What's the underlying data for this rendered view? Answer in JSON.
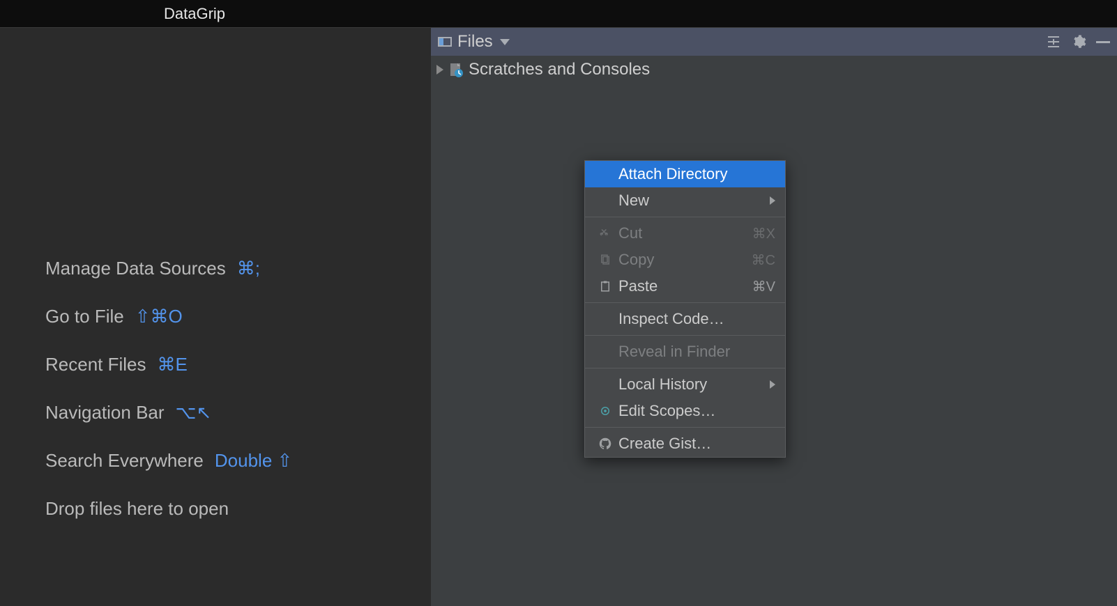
{
  "title": "DataGrip",
  "left": {
    "tips": [
      {
        "label": "Manage Data Sources",
        "shortcut": "⌘;"
      },
      {
        "label": "Go to File",
        "shortcut": "⇧⌘O"
      },
      {
        "label": "Recent Files",
        "shortcut": "⌘E"
      },
      {
        "label": "Navigation Bar",
        "shortcut": "⌥↖"
      },
      {
        "label": "Search Everywhere",
        "shortcut": "Double ⇧"
      },
      {
        "label": "Drop files here to open",
        "shortcut": ""
      }
    ]
  },
  "toolwin": {
    "title": "Files",
    "treeItem": "Scratches and Consoles"
  },
  "menu": {
    "attach": "Attach Directory",
    "new": "New",
    "cut": "Cut",
    "cut_sc": "⌘X",
    "copy": "Copy",
    "copy_sc": "⌘C",
    "paste": "Paste",
    "paste_sc": "⌘V",
    "inspect": "Inspect Code…",
    "reveal": "Reveal in Finder",
    "localhistory": "Local History",
    "editscopes": "Edit Scopes…",
    "gist": "Create Gist…"
  }
}
